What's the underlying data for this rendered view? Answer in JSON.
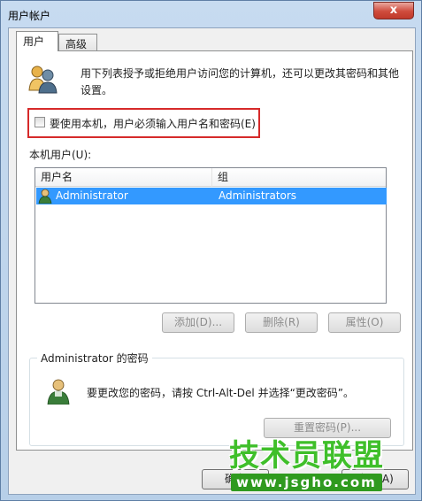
{
  "window": {
    "title": "用户帐户",
    "close_glyph": "x"
  },
  "tabs": [
    {
      "label": "用户"
    },
    {
      "label": "高级"
    }
  ],
  "users_tab": {
    "description": "用下列表授予或拒绝用户访问您的计算机，还可以更改其密码和其他设置。",
    "require_login_label": "要使用本机，用户必须输入用户名和密码(E)",
    "require_login_checked": false,
    "local_users_label": "本机用户(U):",
    "columns": [
      "用户名",
      "组"
    ],
    "rows": [
      {
        "user": "Administrator",
        "group": "Administrators",
        "selected": true
      }
    ],
    "buttons": {
      "add": "添加(D)...",
      "remove": "删除(R)",
      "properties": "属性(O)"
    },
    "password_group": {
      "title": "Administrator 的密码",
      "text": "要更改您的密码，请按 Ctrl-Alt-Del 并选择“更改密码”。",
      "reset_button": "重置密码(P)..."
    }
  },
  "footer": {
    "ok_partial": "确定",
    "apply_partial": "应用(A)"
  },
  "watermark": {
    "line1": "技术员联盟",
    "line2": "www.jsgho.com"
  },
  "colors": {
    "selection": "#3399ff",
    "highlight_box": "#d62a2a",
    "watermark_green": "#3fbf2a"
  }
}
